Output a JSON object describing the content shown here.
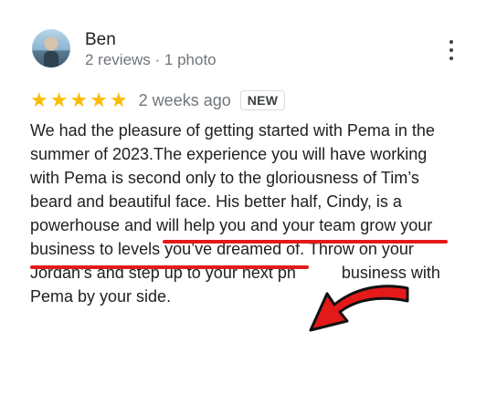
{
  "review": {
    "author": "Ben",
    "meta": "2 reviews · 1 photo",
    "rating": 5,
    "stars": [
      "★",
      "★",
      "★",
      "★",
      "★"
    ],
    "date": "2 weeks ago",
    "badge": "NEW",
    "text_lines": [
      "We had the pleasure of getting started with Pema in the",
      "summer of 2023.The experience you will have working",
      "with Pema is second only to the gloriousness of Tim’s",
      "beard and beautiful face. His better half, Cindy, is a",
      "powerhouse and will help you and your team grow your",
      "business to levels you’ve dreamed of. Throw on your",
      "Jordan’s and step up to your next ph          business with",
      "Pema by your side."
    ]
  },
  "icons": {
    "avatar": "profile-photo",
    "menu": "more-vert-icon",
    "star": "star-icon",
    "annotation": "red-arrow-icon"
  },
  "colors": {
    "star": "#fbbc04",
    "annotation": "#e41a1a",
    "secondary_text": "#70757a"
  }
}
